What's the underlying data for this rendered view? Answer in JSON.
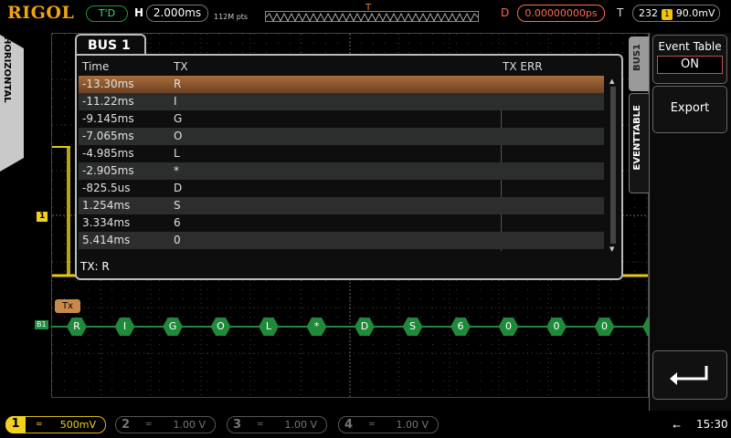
{
  "brand": "RIGOL",
  "status": "T'D",
  "horizontal": {
    "label": "H",
    "timebase": "2.000ms",
    "memory_depth": "112M pts"
  },
  "delay": {
    "label": "D",
    "value": "0.00000000ps"
  },
  "trigger": {
    "label": "T",
    "source": "232",
    "source_channel": "1",
    "level": "90.0mV"
  },
  "side_tab": "HORIZONTAL",
  "bus_panel": {
    "title": "BUS 1",
    "headers": {
      "time": "Time",
      "tx": "TX",
      "tx_err": "TX ERR"
    },
    "rows": [
      {
        "time": "-13.30ms",
        "tx": "R",
        "err": ""
      },
      {
        "time": "-11.22ms",
        "tx": "I",
        "err": ""
      },
      {
        "time": "-9.145ms",
        "tx": "G",
        "err": ""
      },
      {
        "time": "-7.065ms",
        "tx": "O",
        "err": ""
      },
      {
        "time": "-4.985ms",
        "tx": "L",
        "err": ""
      },
      {
        "time": "-2.905ms",
        "tx": "*",
        "err": ""
      },
      {
        "time": "-825.5us",
        "tx": "D",
        "err": ""
      },
      {
        "time": "1.254ms",
        "tx": "S",
        "err": ""
      },
      {
        "time": "3.334ms",
        "tx": "6",
        "err": ""
      },
      {
        "time": "5.414ms",
        "tx": "0",
        "err": ""
      }
    ],
    "selected_row": 0,
    "detail": "TX: R"
  },
  "markers": {
    "ch1": "1",
    "bus": "B1",
    "tx_label": "Tx"
  },
  "decode_packets": [
    "R",
    "I",
    "G",
    "O",
    "L",
    "*",
    "D",
    "S",
    "6",
    "0",
    "0",
    "0",
    "*"
  ],
  "menu": {
    "tab_bus": "BUS1",
    "tab_eventtable": "EVENTTABLE",
    "event_table_label": "Event Table",
    "event_table_value": "ON",
    "export_label": "Export"
  },
  "channels": [
    {
      "num": "1",
      "coupling": "=",
      "scale": "500mV"
    },
    {
      "num": "2",
      "coupling": "=",
      "scale": "1.00 V"
    },
    {
      "num": "3",
      "coupling": "=",
      "scale": "1.00 V"
    },
    {
      "num": "4",
      "coupling": "=",
      "scale": "1.00 V"
    }
  ],
  "clock": "15:30",
  "colors": {
    "ch1": "#f2d020",
    "bus": "#1f8a3a",
    "selected_row": "#a86c3a",
    "delay": "#ff6a4d",
    "brand": "#f3a40e"
  }
}
